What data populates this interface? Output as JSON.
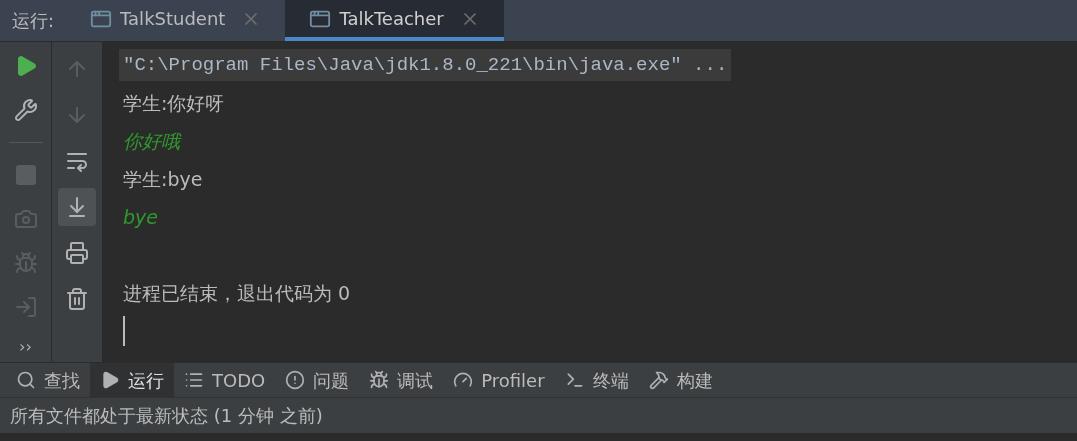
{
  "run_bar": {
    "label": "运行:",
    "tabs": [
      {
        "label": "TalkStudent",
        "selected": false
      },
      {
        "label": "TalkTeacher",
        "selected": true
      }
    ]
  },
  "left_toolbar": [
    {
      "enabled": true
    },
    {
      "enabled": true
    },
    {
      "enabled": false
    },
    {
      "enabled": false
    },
    {
      "enabled": false
    },
    {
      "enabled": false
    }
  ],
  "more_label": "››",
  "console_toolbar": [
    {
      "enabled": false,
      "toggled": false
    },
    {
      "enabled": false,
      "toggled": false
    },
    {
      "enabled": true,
      "toggled": false
    },
    {
      "enabled": true,
      "toggled": true
    },
    {
      "enabled": true,
      "toggled": false
    },
    {
      "enabled": true,
      "toggled": false
    }
  ],
  "console": {
    "lines": [
      {
        "kind": "command",
        "text": "\"C:\\Program Files\\Java\\jdk1.8.0_221\\bin\\java.exe\" ..."
      },
      {
        "kind": "output",
        "text": "学生:你好呀"
      },
      {
        "kind": "input",
        "text": "你好哦"
      },
      {
        "kind": "output",
        "text": "学生:bye"
      },
      {
        "kind": "input",
        "text": "bye"
      },
      {
        "kind": "blank"
      },
      {
        "kind": "output",
        "text": "进程已结束，退出代码为 0"
      }
    ]
  },
  "tool_tabs": [
    {
      "label": "查找",
      "selected": false
    },
    {
      "label": "运行",
      "selected": true
    },
    {
      "label": "TODO",
      "selected": false
    },
    {
      "label": "问题",
      "selected": false
    },
    {
      "label": "调试",
      "selected": false
    },
    {
      "label": "Profiler",
      "selected": false
    },
    {
      "label": "终端",
      "selected": false
    },
    {
      "label": "构建",
      "selected": false
    }
  ],
  "status_bar": "所有文件都处于最新状态 (1 分钟 之前)"
}
